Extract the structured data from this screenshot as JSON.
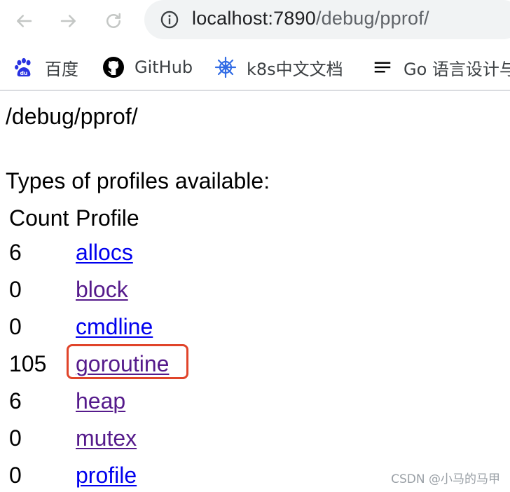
{
  "browser": {
    "url_host": "localhost:7890",
    "url_path": "/debug/pprof/"
  },
  "bookmarks": [
    {
      "label": "百度",
      "icon": "baidu-paw-icon",
      "color": "#2932e1"
    },
    {
      "label": "GitHub",
      "icon": "github-icon",
      "color": "#000000"
    },
    {
      "label": "k8s中文文档",
      "icon": "kubernetes-helm-icon",
      "color": "#326ce5"
    },
    {
      "label": "Go 语言设计与",
      "icon": "menu-lines-icon",
      "color": "#000000"
    }
  ],
  "page": {
    "heading": "/debug/pprof/",
    "subheading": "Types of profiles available:",
    "table": {
      "headers": [
        "Count",
        "Profile"
      ],
      "rows": [
        {
          "count": "6",
          "profile": "allocs",
          "visited": false
        },
        {
          "count": "0",
          "profile": "block",
          "visited": true
        },
        {
          "count": "0",
          "profile": "cmdline",
          "visited": false
        },
        {
          "count": "105",
          "profile": "goroutine",
          "visited": true,
          "highlighted": true
        },
        {
          "count": "6",
          "profile": "heap",
          "visited": true
        },
        {
          "count": "0",
          "profile": "mutex",
          "visited": true
        },
        {
          "count": "0",
          "profile": "profile",
          "visited": false
        }
      ]
    }
  },
  "watermark": "CSDN @小马的马甲",
  "colors": {
    "link": "#0000ee",
    "visited_link": "#551a8b",
    "highlight_box": "#e0442a"
  }
}
